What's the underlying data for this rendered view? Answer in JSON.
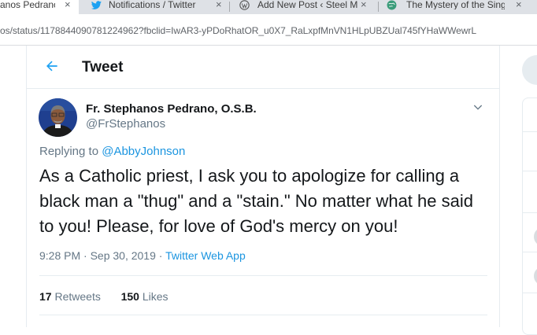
{
  "browser": {
    "tabs": [
      {
        "label": "anos Pedrano",
        "active": true
      },
      {
        "label": "Notifications / Twitter",
        "active": false
      },
      {
        "label": "Add New Post ‹ Steel M",
        "active": false
      },
      {
        "label": "The Mystery of the Sing",
        "active": false
      }
    ],
    "close_glyph": "×",
    "url": "os/status/1178844090781224962?fbclid=IwAR3-yPDoRhatOR_u0X7_RaLxpfMnVN1HLpUBZUal745fYHaWWewrL"
  },
  "header": {
    "title": "Tweet",
    "back_icon": "back-arrow-icon"
  },
  "tweet": {
    "author_name": "Fr. Stephanos Pedrano, O.S.B.",
    "handle": "@FrStephanos",
    "replying_prefix": "Replying to",
    "replying_to": "@AbbyJohnson",
    "text": "As a Catholic priest, I ask you to apologize for calling a black man a \"thug\" and a \"stain.\" No matter what he said to you! Please, for love of God's mercy on you!",
    "time": "9:28 PM · Sep 30, 2019 · ",
    "source": "Twitter Web App",
    "retweets_count": "17",
    "retweets_label": "Retweets",
    "likes_count": "150",
    "likes_label": "Likes"
  },
  "colors": {
    "accent": "#1da1f2",
    "link": "#1b95e0",
    "text": "#14171a",
    "secondary": "#657786",
    "border": "#e6ecf0"
  }
}
